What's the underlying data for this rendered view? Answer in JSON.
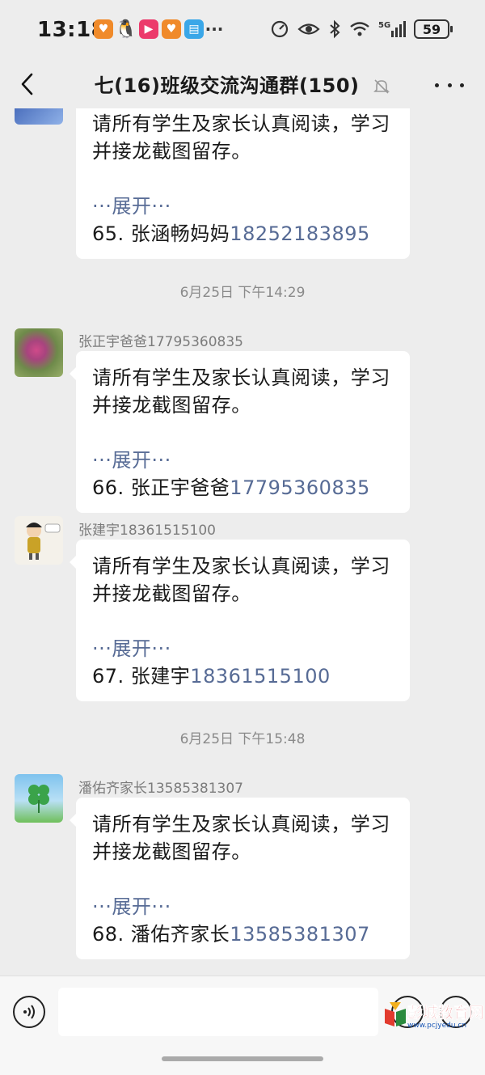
{
  "status_bar": {
    "time": "13:18",
    "battery": "59",
    "network": "5G",
    "notification_icons": [
      "taobao-icon",
      "qq-icon",
      "video-icon",
      "taobao-icon",
      "book-icon",
      "more-icon"
    ]
  },
  "header": {
    "title": "七(16)班级交流沟通群(150)",
    "muted": true
  },
  "messages": [
    {
      "sender": "",
      "text_line1": "请所有学生及家长认真阅读，学习",
      "text_line2": "并接龙截图留存。",
      "expand": "···展开···",
      "entry_name": "65. 张涵畅妈妈",
      "entry_phone": "18252183895"
    },
    {
      "timestamp": "6月25日 下午14:29",
      "sender": "张正宇爸爸17795360835",
      "text_line1": "请所有学生及家长认真阅读，学习",
      "text_line2": "并接龙截图留存。",
      "expand": "···展开···",
      "entry_name": "66. 张正宇爸爸",
      "entry_phone": "17795360835"
    },
    {
      "sender": "张建宇18361515100",
      "text_line1": "请所有学生及家长认真阅读，学习",
      "text_line2": "并接龙截图留存。",
      "expand": "···展开···",
      "entry_name": "67. 张建宇",
      "entry_phone": "18361515100"
    },
    {
      "timestamp": "6月25日 下午15:48",
      "sender": "潘佑齐家长13585381307",
      "text_line1": "请所有学生及家长认真阅读，学习",
      "text_line2": "并接龙截图留存。",
      "expand": "···展开···",
      "entry_name": "68. 潘佑齐家长",
      "entry_phone": "13585381307"
    }
  ],
  "watermark": {
    "text": "彭城教育网",
    "url": "www.pcjyedu.cn"
  },
  "colors": {
    "background": "#ededed",
    "bubble": "#ffffff",
    "link": "#576b95",
    "meta_text": "#8a8a8a"
  }
}
